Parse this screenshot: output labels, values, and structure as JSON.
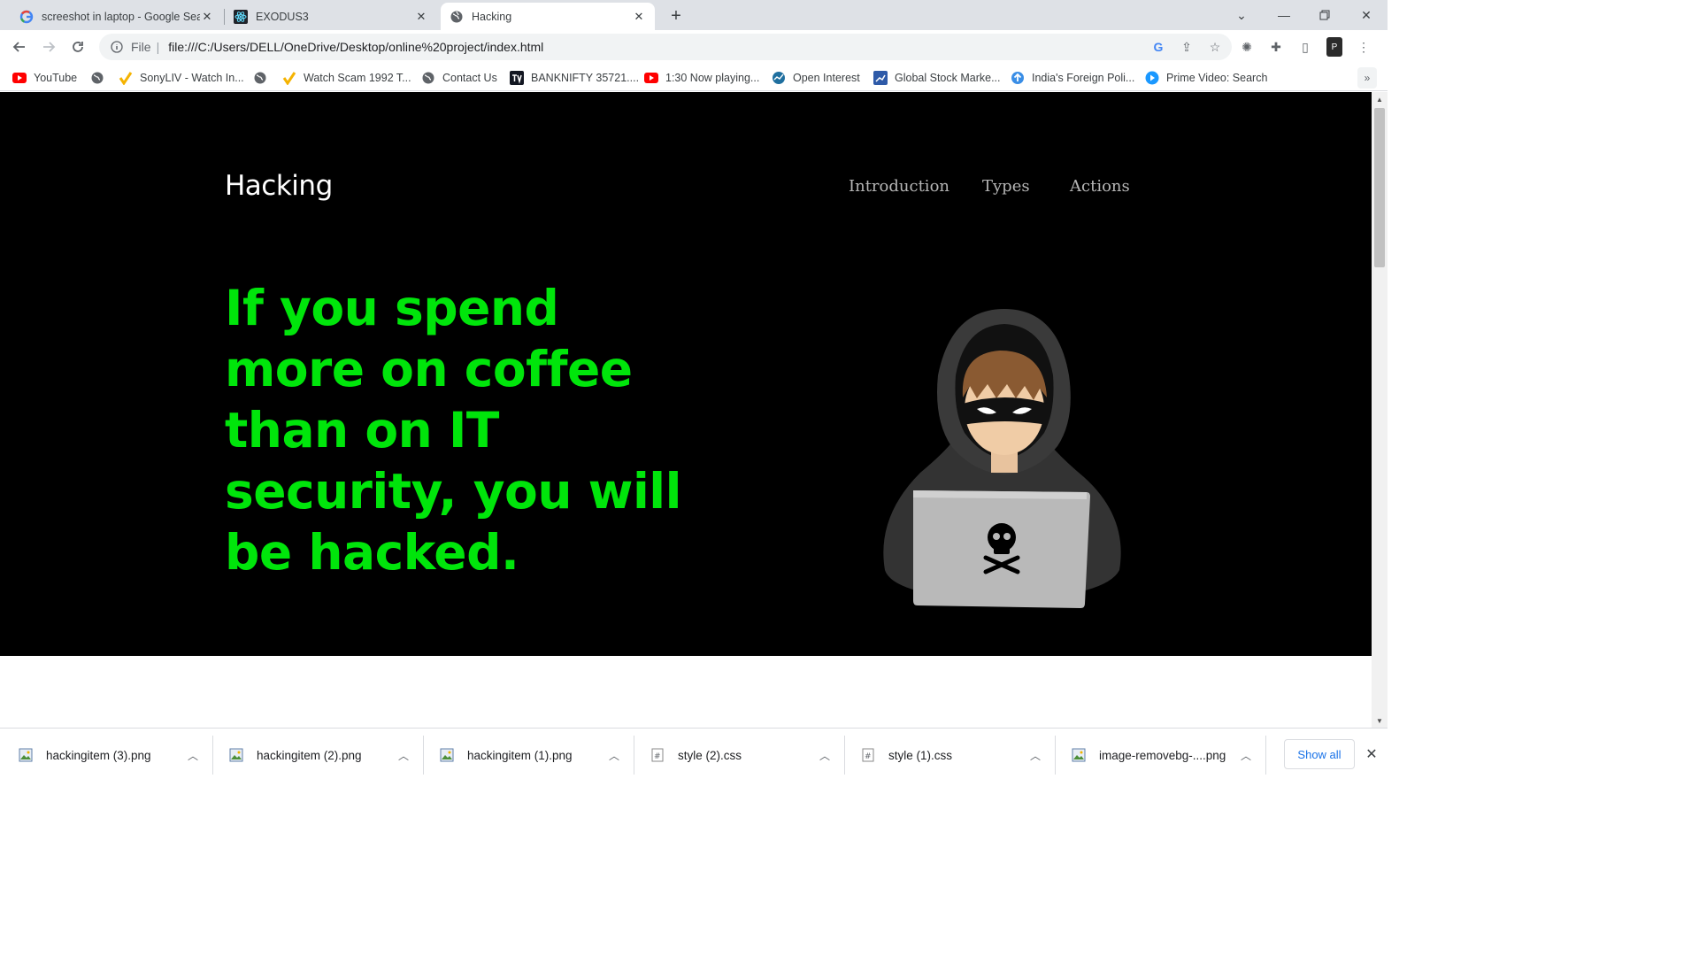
{
  "tabs": [
    {
      "title": "screeshot in laptop - Google Search",
      "icon": "google-icon"
    },
    {
      "title": "EXODUS3",
      "icon": "react-icon"
    },
    {
      "title": "Hacking",
      "icon": "globe-icon",
      "active": true
    }
  ],
  "address": {
    "scheme": "File",
    "url": "file:///C:/Users/DELL/OneDrive/Desktop/online%20project/index.html"
  },
  "bookmarks": [
    {
      "label": "YouTube",
      "icon": "youtube-icon"
    },
    {
      "label": "",
      "icon": "globe-icon"
    },
    {
      "label": "SonyLIV - Watch In...",
      "icon": "sonyliv-icon"
    },
    {
      "label": "",
      "icon": "globe-icon"
    },
    {
      "label": "Watch Scam 1992 T...",
      "icon": "sonyliv-icon"
    },
    {
      "label": "Contact Us",
      "icon": "globe-icon"
    },
    {
      "label": "BANKNIFTY 35721....",
      "icon": "tradingview-icon"
    },
    {
      "label": "1:30 Now playing...",
      "icon": "youtube-icon"
    },
    {
      "label": "Open Interest",
      "icon": "oi-icon"
    },
    {
      "label": "Global Stock Marke...",
      "icon": "chart-icon"
    },
    {
      "label": "India's Foreign Poli...",
      "icon": "upload-icon"
    },
    {
      "label": "Prime Video: Search",
      "icon": "prime-video-icon"
    }
  ],
  "page": {
    "logo": "Hacking",
    "nav": [
      "Introduction",
      "Types",
      "Actions"
    ],
    "headline": "If you spend more on coffee than on IT security, you will be hacked.",
    "hero_bg": "#000000",
    "headline_color": "#00e50b"
  },
  "downloads": [
    {
      "name": "hackingitem (3).png",
      "type": "image"
    },
    {
      "name": "hackingitem (2).png",
      "type": "image"
    },
    {
      "name": "hackingitem (1).png",
      "type": "image"
    },
    {
      "name": "style (2).css",
      "type": "css"
    },
    {
      "name": "style (1).css",
      "type": "css"
    },
    {
      "name": "image-removebg-....png",
      "type": "image"
    }
  ],
  "show_all": "Show all"
}
